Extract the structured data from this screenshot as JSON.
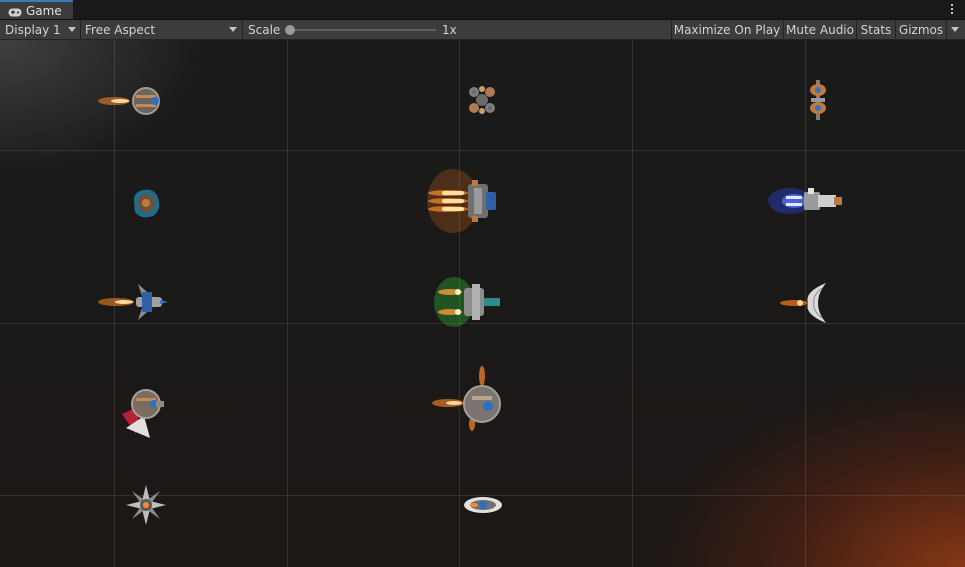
{
  "tab": {
    "label": "Game",
    "icon": "gamepad-icon"
  },
  "menu": {
    "icon": "kebab-menu-icon"
  },
  "toolbar": {
    "display": "Display 1",
    "aspect": "Free Aspect",
    "scale_label": "Scale",
    "scale_value": "1x",
    "scale_fraction": 0,
    "maximize": "Maximize On Play",
    "mute": "Mute Audio",
    "stats": "Stats",
    "gizmos": "Gizmos"
  },
  "colors": {
    "accent": "#3a79bb",
    "panel": "#3c3c3c",
    "thruster_orange": "#ff8a2a",
    "thruster_blue": "#3a6cff",
    "thruster_green": "#3ccf4a"
  },
  "scene": {
    "sprites": [
      {
        "name": "sphere-fighter",
        "icon": "sphere-fighter-ship-icon",
        "thruster": "orange"
      },
      {
        "name": "cluster-drone",
        "icon": "cluster-drone-ship-icon",
        "thruster": "none"
      },
      {
        "name": "twin-pod-drone",
        "icon": "twin-pod-drone-ship-icon",
        "thruster": "none"
      },
      {
        "name": "asteroid-pod",
        "icon": "asteroid-pod-ship-icon",
        "thruster": "none"
      },
      {
        "name": "heavy-cruiser",
        "icon": "heavy-cruiser-ship-icon",
        "thruster": "orange"
      },
      {
        "name": "blue-thruster-ship",
        "icon": "blue-thruster-ship-icon",
        "thruster": "blue"
      },
      {
        "name": "winged-fighter",
        "icon": "winged-fighter-ship-icon",
        "thruster": "orange"
      },
      {
        "name": "green-thruster-ship",
        "icon": "green-thruster-ship-icon",
        "thruster": "green"
      },
      {
        "name": "crescent-ship",
        "icon": "crescent-ship-icon",
        "thruster": "orange"
      },
      {
        "name": "red-fin-ship",
        "icon": "red-fin-ship-icon",
        "thruster": "none"
      },
      {
        "name": "round-gunship",
        "icon": "round-gunship-ship-icon",
        "thruster": "orange"
      },
      {
        "name": "star-mine",
        "icon": "star-mine-icon",
        "thruster": "none"
      },
      {
        "name": "eye-saucer",
        "icon": "eye-saucer-ship-icon",
        "thruster": "none"
      }
    ]
  }
}
